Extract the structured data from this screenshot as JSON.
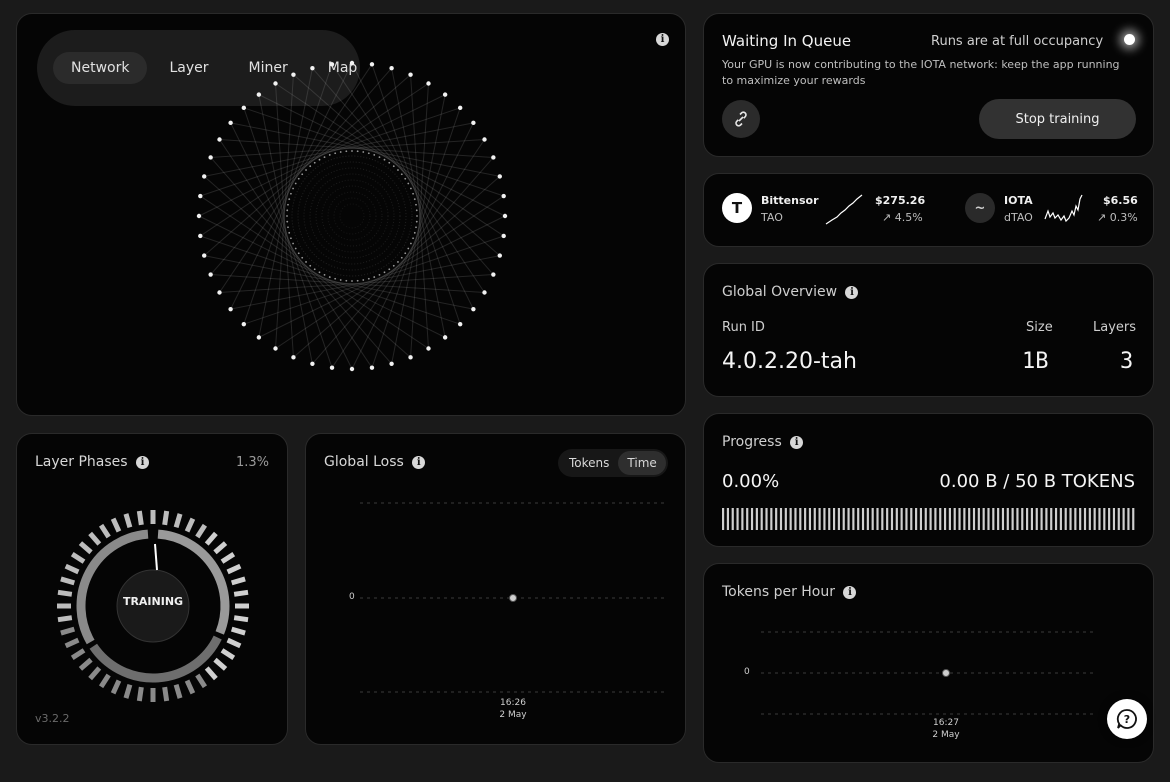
{
  "network": {
    "tabs": [
      {
        "label": "Network",
        "active": true
      },
      {
        "label": "Layer",
        "active": false
      },
      {
        "label": "Miner",
        "active": false
      },
      {
        "label": "Map",
        "active": false
      }
    ],
    "info_icon": "info-icon"
  },
  "queue": {
    "title": "Waiting In Queue",
    "status": "Runs are at full occupancy",
    "description": "Your GPU is now contributing to the IOTA network: keep the app running to maximize your rewards",
    "link_icon": "link-icon",
    "stop_label": "Stop training"
  },
  "ticker": {
    "coins": [
      {
        "logo": "T",
        "name": "Bittensor",
        "ticker": "TAO",
        "price": "$275.26",
        "change": "↗ 4.5%"
      },
      {
        "logo": "~",
        "name": "IOTA",
        "ticker": "dTAO",
        "price": "$6.56",
        "change": "↗ 0.3%"
      }
    ]
  },
  "overview": {
    "title": "Global Overview",
    "run_id_label": "Run ID",
    "run_id": "4.0.2.20-tah",
    "size_label": "Size",
    "size": "1B",
    "layers_label": "Layers",
    "layers": "3"
  },
  "progress": {
    "title": "Progress",
    "percent": "0.00%",
    "tokens": "0.00 B /  50 B TOKENS"
  },
  "tph": {
    "title": "Tokens per Hour",
    "y_tick": "0",
    "x_time": "16:27",
    "x_date": "2 May"
  },
  "phases": {
    "title": "Layer Phases",
    "percent": "1.3%",
    "center_label": "TRAINING",
    "version": "v3.2.2"
  },
  "loss": {
    "title": "Global Loss",
    "toggle": [
      {
        "label": "Tokens",
        "active": false
      },
      {
        "label": "Time",
        "active": true
      }
    ],
    "y_tick": "0",
    "x_time": "16:26",
    "x_date": "2 May"
  },
  "help_icon": "help-chat-icon",
  "colors": {
    "card_bg": "#050505",
    "page_bg": "#1a1a1a",
    "accent": "#ffffff"
  }
}
